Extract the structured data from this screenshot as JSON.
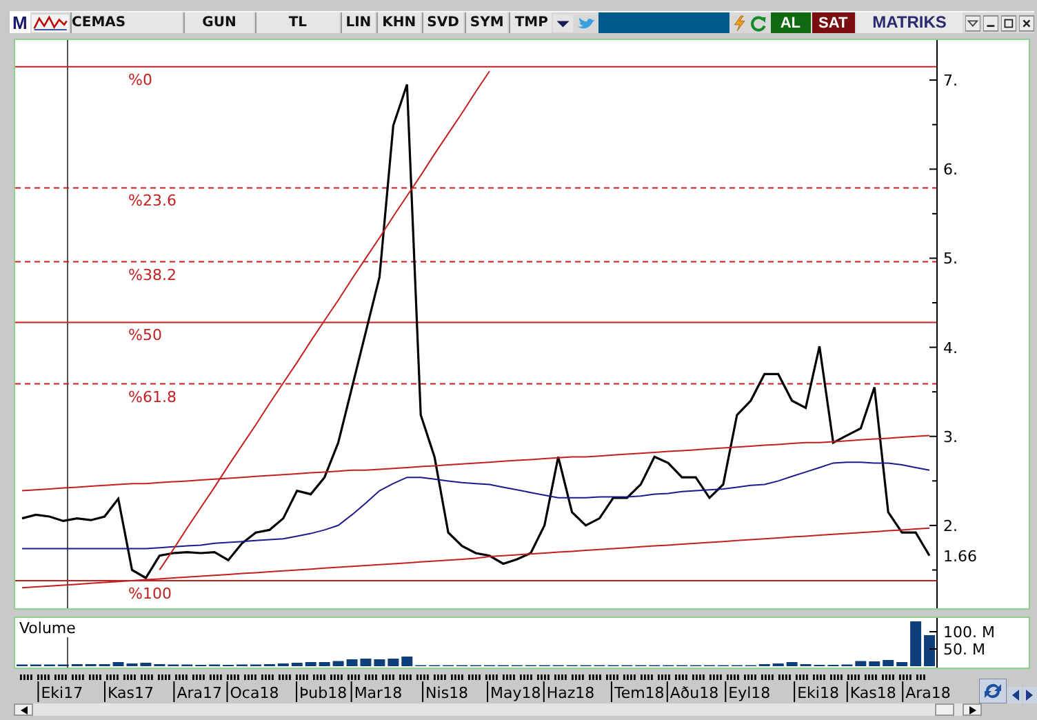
{
  "toolbar": {
    "logo": "M",
    "symbol": "CEMAS",
    "buttons": [
      {
        "label": "GUN"
      },
      {
        "label": "TL"
      },
      {
        "label": "LIN"
      },
      {
        "label": "KHN"
      },
      {
        "label": "SVD"
      },
      {
        "label": "SYM"
      },
      {
        "label": "TMP"
      }
    ],
    "buy_button": "AL",
    "sell_button": "SAT",
    "brand": "MATRIKS"
  },
  "price_chart": {
    "chart_data": {
      "type": "line",
      "categories": [
        null,
        null,
        null,
        null,
        null,
        null,
        null,
        null,
        null,
        null,
        null,
        null,
        null,
        null,
        null,
        null,
        null,
        null,
        null,
        null,
        null,
        null,
        null,
        null,
        null,
        null,
        null,
        null,
        null,
        null,
        null,
        null,
        null,
        null,
        null,
        null,
        null,
        null,
        null,
        null,
        null,
        null,
        null,
        null,
        null,
        null,
        null,
        null,
        null,
        null,
        null,
        null,
        null,
        null,
        null,
        null,
        null,
        null,
        null,
        null,
        null,
        null,
        null,
        null,
        null,
        null,
        null
      ],
      "series": [
        {
          "color": "#000000",
          "values": [
            2.08,
            2.12,
            2.1,
            2.05,
            2.08,
            2.06,
            2.1,
            2.3,
            1.5,
            1.41,
            1.66,
            1.69,
            1.7,
            1.69,
            1.7,
            1.61,
            1.8,
            1.92,
            1.95,
            2.08,
            2.39,
            2.35,
            2.54,
            2.93,
            3.55,
            4.17,
            4.79,
            6.49,
            6.95,
            3.24,
            2.77,
            1.92,
            1.77,
            1.69,
            1.66,
            1.57,
            1.62,
            1.69,
            2.0,
            2.77,
            2.15,
            2.0,
            2.08,
            2.31,
            2.31,
            2.46,
            2.77,
            2.7,
            2.54,
            2.54,
            2.31,
            2.46,
            3.24,
            3.4,
            3.7,
            3.7,
            3.4,
            3.32,
            4.01,
            2.93,
            3.01,
            3.09,
            3.55,
            2.15,
            1.92,
            1.92,
            1.66
          ]
        },
        {
          "color": "#1a1a8c",
          "values": [
            1.74,
            1.74,
            1.74,
            1.74,
            1.74,
            1.74,
            1.74,
            1.74,
            1.74,
            1.74,
            1.75,
            1.76,
            1.77,
            1.78,
            1.8,
            1.81,
            1.82,
            1.83,
            1.84,
            1.85,
            1.88,
            1.91,
            1.95,
            2.0,
            2.12,
            2.25,
            2.39,
            2.47,
            2.54,
            2.54,
            2.52,
            2.5,
            2.48,
            2.47,
            2.46,
            2.43,
            2.4,
            2.37,
            2.34,
            2.31,
            2.31,
            2.31,
            2.32,
            2.32,
            2.32,
            2.33,
            2.35,
            2.36,
            2.38,
            2.39,
            2.4,
            2.41,
            2.43,
            2.45,
            2.46,
            2.5,
            2.55,
            2.6,
            2.65,
            2.7,
            2.71,
            2.71,
            2.7,
            2.7,
            2.68,
            2.65,
            2.62
          ]
        },
        {
          "color": "#c41e1e",
          "values": [
            2.39,
            2.4,
            2.41,
            2.42,
            2.43,
            2.44,
            2.45,
            2.46,
            2.47,
            2.47,
            2.48,
            2.49,
            2.5,
            2.51,
            2.52,
            2.53,
            2.54,
            2.55,
            2.56,
            2.57,
            2.58,
            2.59,
            2.6,
            2.61,
            2.62,
            2.62,
            2.63,
            2.64,
            2.65,
            2.66,
            2.67,
            2.68,
            2.69,
            2.7,
            2.71,
            2.72,
            2.73,
            2.74,
            2.75,
            2.76,
            2.77,
            2.77,
            2.78,
            2.79,
            2.8,
            2.81,
            2.82,
            2.83,
            2.84,
            2.85,
            2.86,
            2.87,
            2.88,
            2.89,
            2.9,
            2.91,
            2.92,
            2.93,
            2.93,
            2.94,
            2.95,
            2.96,
            2.97,
            2.98,
            2.99,
            3.0,
            3.01
          ]
        },
        {
          "color": "#c41e1e",
          "values": [
            1.3,
            1.31,
            1.32,
            1.33,
            1.34,
            1.35,
            1.36,
            1.37,
            1.38,
            1.39,
            1.4,
            1.41,
            1.42,
            1.43,
            1.44,
            1.45,
            1.46,
            1.47,
            1.48,
            1.49,
            1.5,
            1.51,
            1.52,
            1.53,
            1.54,
            1.55,
            1.56,
            1.57,
            1.58,
            1.59,
            1.6,
            1.61,
            1.62,
            1.63,
            1.65,
            1.66,
            1.67,
            1.68,
            1.69,
            1.7,
            1.71,
            1.72,
            1.73,
            1.74,
            1.75,
            1.76,
            1.77,
            1.78,
            1.79,
            1.8,
            1.81,
            1.82,
            1.83,
            1.84,
            1.85,
            1.86,
            1.87,
            1.88,
            1.89,
            1.9,
            1.91,
            1.92,
            1.93,
            1.94,
            1.95,
            1.96,
            1.97
          ]
        },
        {
          "color": "#c41e1e",
          "values": [
            null,
            null,
            null,
            null,
            null,
            null,
            null,
            null,
            null,
            null,
            1.5,
            1.73,
            1.97,
            2.2,
            2.43,
            2.67,
            2.9,
            3.13,
            3.37,
            3.6,
            3.83,
            4.07,
            4.3,
            4.53,
            4.77,
            5.0,
            5.23,
            5.47,
            5.7,
            5.93,
            6.17,
            6.4,
            6.63,
            6.87,
            7.1,
            null,
            null,
            null,
            null,
            null,
            null,
            null,
            null,
            null,
            null,
            null,
            null,
            null,
            null,
            null,
            null,
            null,
            null,
            null,
            null,
            null,
            null,
            null,
            null,
            null,
            null,
            null,
            null,
            null,
            null,
            null,
            null
          ]
        }
      ],
      "ylim": [
        1.07,
        7.45
      ],
      "yticks": [
        {
          "value": 2,
          "label": "2."
        },
        {
          "value": 3,
          "label": "3."
        },
        {
          "value": 4,
          "label": "4."
        },
        {
          "value": 5,
          "label": "5."
        },
        {
          "value": 6,
          "label": "6."
        },
        {
          "value": 7,
          "label": "7."
        },
        {
          "value": 1.66,
          "label": "1.66"
        }
      ],
      "ref_lines": [
        {
          "axis": "y",
          "value": 7.15
        },
        {
          "axis": "y",
          "value": 5.79
        },
        {
          "axis": "y",
          "value": 4.96
        },
        {
          "axis": "y",
          "value": 4.28
        },
        {
          "axis": "y",
          "value": 3.59
        },
        {
          "axis": "y",
          "value": 1.38
        }
      ],
      "annotations": [
        "%0",
        "%23.6",
        "%38.2",
        "%50",
        "%61.8",
        "%100"
      ]
    }
  },
  "volume_chart": {
    "chart_data": {
      "type": "bar",
      "title": "Volume",
      "categories": [
        null,
        null,
        null,
        "Eki17",
        null,
        null,
        null,
        null,
        "Kas17",
        null,
        null,
        null,
        null,
        "Ara17",
        null,
        null,
        null,
        "Oca18",
        null,
        null,
        null,
        null,
        "Þub18",
        null,
        null,
        null,
        "Mar18",
        null,
        null,
        null,
        null,
        "Nis18",
        null,
        null,
        null,
        null,
        "May18",
        null,
        null,
        null,
        "Haz18",
        null,
        null,
        null,
        null,
        "Tem18",
        null,
        null,
        null,
        "Aðu18",
        null,
        null,
        null,
        "Eyl18",
        null,
        null,
        null,
        null,
        "Eki18",
        null,
        null,
        null,
        "Kas18",
        null,
        null,
        null,
        "Ara18"
      ],
      "values": [
        5,
        5,
        5,
        5,
        6,
        6,
        6,
        12,
        8,
        10,
        6,
        5,
        5,
        4,
        5,
        4,
        5,
        5,
        6,
        8,
        10,
        12,
        12,
        15,
        20,
        22,
        20,
        22,
        28,
        3,
        3,
        3,
        3,
        3,
        3,
        3,
        3,
        3,
        3,
        3,
        3,
        3,
        3,
        3,
        3,
        3,
        3,
        3,
        3,
        3,
        3,
        3,
        3,
        3,
        6,
        8,
        12,
        6,
        4,
        4,
        5,
        15,
        14,
        18,
        12,
        130,
        90
      ],
      "ylim": [
        -4,
        140
      ],
      "yticks": [
        {
          "value": 50,
          "label": "50. M"
        },
        {
          "value": 100,
          "label": "100. M"
        }
      ]
    }
  }
}
